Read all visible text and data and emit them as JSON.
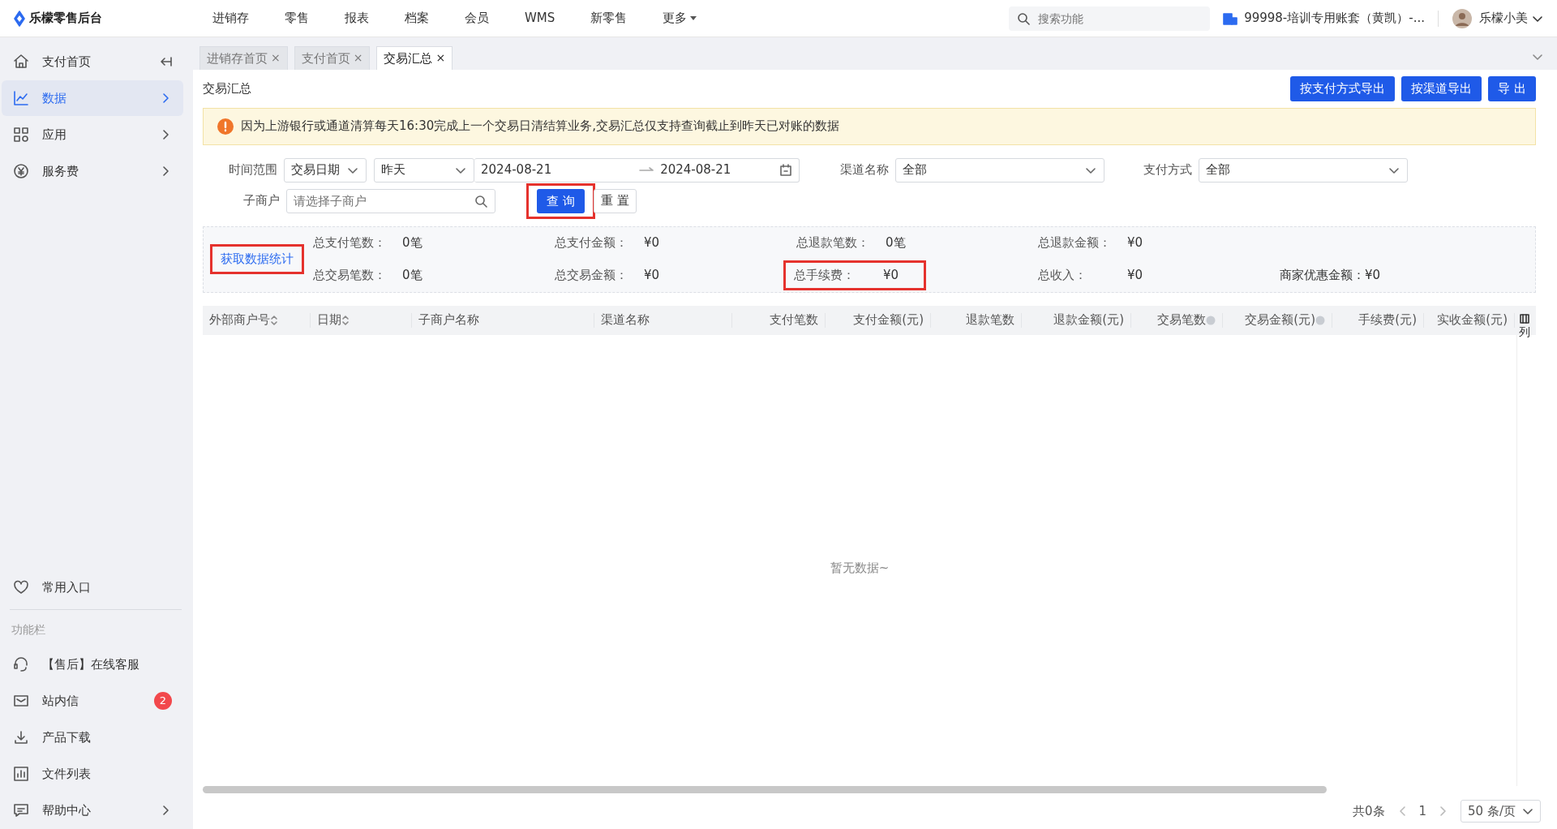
{
  "topbar": {
    "logo": "乐檬零售后台",
    "menu": [
      {
        "label": "进销存",
        "dropdown": false
      },
      {
        "label": "零售",
        "dropdown": false
      },
      {
        "label": "报表",
        "dropdown": false
      },
      {
        "label": "档案",
        "dropdown": false
      },
      {
        "label": "会员",
        "dropdown": false
      },
      {
        "label": "WMS",
        "dropdown": false
      },
      {
        "label": "新零售",
        "dropdown": false
      },
      {
        "label": "更多",
        "dropdown": true
      }
    ],
    "search": {
      "placeholder": "搜索功能"
    },
    "account": "99998-培训专用账套（黄凯）-...",
    "user": "乐檬小美"
  },
  "sidebar": {
    "items": [
      {
        "label": "支付首页",
        "selected": false,
        "expandable": false
      },
      {
        "label": "数据",
        "selected": true,
        "expandable": true
      },
      {
        "label": "应用",
        "selected": false,
        "expandable": true
      },
      {
        "label": "服务费",
        "selected": false,
        "expandable": true
      }
    ],
    "favorites": "常用入口",
    "section_title": "功能栏",
    "tools": [
      {
        "label": "【售后】在线客服",
        "expandable": false
      },
      {
        "label": "站内信",
        "badge": "2",
        "expandable": false
      },
      {
        "label": "产品下载",
        "expandable": false
      },
      {
        "label": "文件列表",
        "expandable": false
      },
      {
        "label": "帮助中心",
        "expandable": true
      }
    ]
  },
  "tabs": [
    {
      "label": "进销存首页",
      "close": "×",
      "selected": false
    },
    {
      "label": "支付首页",
      "close": "×",
      "selected": false
    },
    {
      "label": "交易汇总",
      "close": "×",
      "selected": true
    }
  ],
  "page": {
    "title": "交易汇总",
    "buttons": [
      "按支付方式导出",
      "按渠道导出",
      "导 出"
    ],
    "notice": "因为上游银行或通道清算每天16:30完成上一个交易日清结算业务,交易汇总仅支持查询截止到昨天已对账的数据"
  },
  "filters": {
    "time_label": "时间范围",
    "date_type": "交易日期",
    "period": "昨天",
    "start_date": "2024-08-21",
    "end_date": "2024-08-21",
    "channel_label": "渠道名称",
    "channel": "全部",
    "payment_label": "支付方式",
    "payment": "全部",
    "merchant_label": "子商户",
    "merchant": {
      "placeholder": "请选择子商户"
    },
    "buttons": [
      {
        "label": "查 询",
        "kind": "primary",
        "highlighted": true
      },
      {
        "label": "重 置",
        "kind": "default",
        "highlighted": false
      }
    ]
  },
  "stats": {
    "link": {
      "label": "获取数据统计",
      "highlighted": true
    },
    "rows": [
      [
        {
          "label": "总支付笔数：",
          "value": "0笔",
          "highlighted": false
        },
        {
          "label": "总支付金额：",
          "value": "¥0",
          "highlighted": false
        },
        {
          "label": "总退款笔数：",
          "value": "0笔",
          "highlighted": false
        },
        {
          "label": "总退款金额：",
          "value": "¥0",
          "highlighted": false
        }
      ],
      [
        {
          "label": "总交易笔数：",
          "value": "0笔",
          "highlighted": false
        },
        {
          "label": "总交易金额：",
          "value": "¥0",
          "highlighted": false
        },
        {
          "label": "总手续费：",
          "value": "¥0",
          "highlighted": true
        },
        {
          "label": "总收入：",
          "value": "¥0",
          "highlighted": false
        },
        {
          "label": "商家优惠金额：",
          "value": "¥0",
          "highlighted": false
        }
      ]
    ]
  },
  "table": {
    "columns": [
      {
        "label": "外部商户号",
        "sortable": true,
        "info": false
      },
      {
        "label": "日期",
        "sortable": true,
        "info": false
      },
      {
        "label": "子商户名称",
        "sortable": false,
        "info": false
      },
      {
        "label": "渠道名称",
        "sortable": false,
        "info": false
      },
      {
        "label": "支付笔数",
        "sortable": false,
        "info": false
      },
      {
        "label": "支付金额(元)",
        "sortable": false,
        "info": false
      },
      {
        "label": "退款笔数",
        "sortable": false,
        "info": false
      },
      {
        "label": "退款金额(元)",
        "sortable": false,
        "info": false
      },
      {
        "label": "交易笔数",
        "sortable": false,
        "info": true
      },
      {
        "label": "交易金额(元)",
        "sortable": false,
        "info": true
      },
      {
        "label": "手续费(元)",
        "sortable": false,
        "info": false
      },
      {
        "label": "实收金额(元)",
        "sortable": false,
        "info": false
      }
    ],
    "column_settings": "列",
    "empty": "暂无数据~"
  },
  "pagination": {
    "total": "共0条",
    "page": "1",
    "page_size": "50 条/页"
  }
}
